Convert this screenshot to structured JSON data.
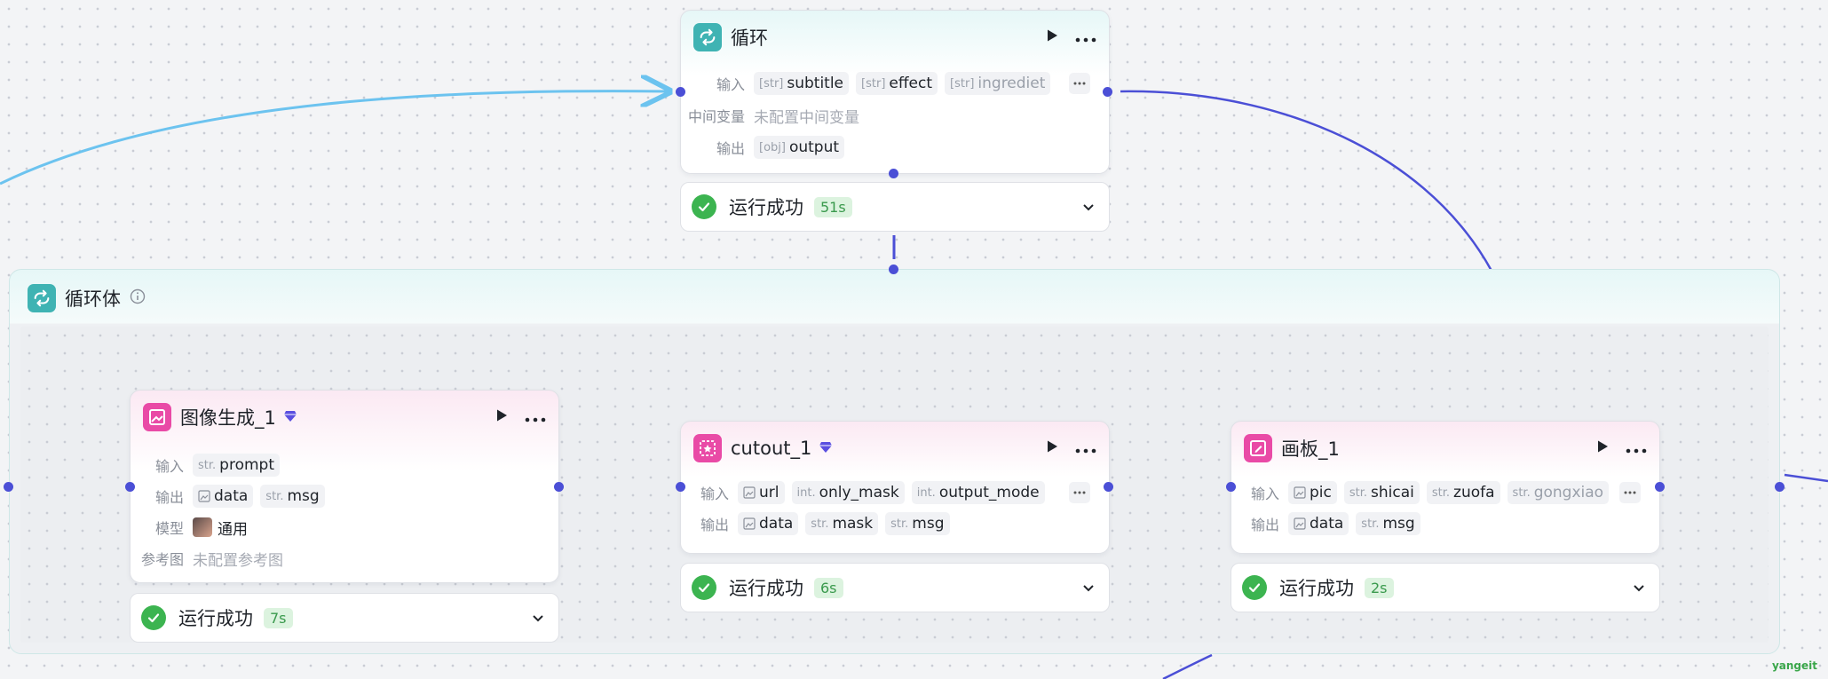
{
  "loop_node": {
    "title": "循环",
    "input_label": "输入",
    "inputs": [
      {
        "type": "[str]",
        "name": "subtitle"
      },
      {
        "type": "[str]",
        "name": "effect"
      },
      {
        "type": "[str]",
        "name": "ingrediet"
      }
    ],
    "mid_label": "中间变量",
    "mid_value": "未配置中间变量",
    "output_label": "输出",
    "outputs": [
      {
        "type": "[obj]",
        "name": "output"
      }
    ]
  },
  "loop_status": {
    "text": "运行成功",
    "time": "51s"
  },
  "loop_body": {
    "title": "循环体"
  },
  "image_gen_node": {
    "title": "图像生成_1",
    "input_label": "输入",
    "inputs": [
      {
        "type": "str.",
        "name": "prompt"
      }
    ],
    "output_label": "输出",
    "outputs": [
      {
        "type": "image",
        "name": "data"
      },
      {
        "type": "str.",
        "name": "msg"
      }
    ],
    "model_label": "模型",
    "model_value": "通用",
    "ref_label": "参考图",
    "ref_value": "未配置参考图"
  },
  "image_gen_status": {
    "text": "运行成功",
    "time": "7s"
  },
  "cutout_node": {
    "title": "cutout_1",
    "input_label": "输入",
    "inputs": [
      {
        "type": "image",
        "name": "url"
      },
      {
        "type": "int.",
        "name": "only_mask"
      },
      {
        "type": "int.",
        "name": "output_mode"
      }
    ],
    "output_label": "输出",
    "outputs": [
      {
        "type": "image",
        "name": "data"
      },
      {
        "type": "str.",
        "name": "mask"
      },
      {
        "type": "str.",
        "name": "msg"
      }
    ]
  },
  "cutout_status": {
    "text": "运行成功",
    "time": "6s"
  },
  "canvas_node": {
    "title": "画板_1",
    "input_label": "输入",
    "inputs": [
      {
        "type": "image",
        "name": "pic"
      },
      {
        "type": "str.",
        "name": "shicai"
      },
      {
        "type": "str.",
        "name": "zuofa"
      },
      {
        "type": "str.",
        "name": "gongxiao"
      }
    ],
    "output_label": "输出",
    "outputs": [
      {
        "type": "image",
        "name": "data"
      },
      {
        "type": "str.",
        "name": "msg"
      }
    ]
  },
  "canvas_status": {
    "text": "运行成功",
    "time": "2s"
  },
  "watermark": "yangeit",
  "colors": {
    "wire": "#4b4fd6",
    "wire_light": "#6cc3ef",
    "success": "#3cb450",
    "teal": "#3fb3b3",
    "pink": "#e94aa6"
  }
}
